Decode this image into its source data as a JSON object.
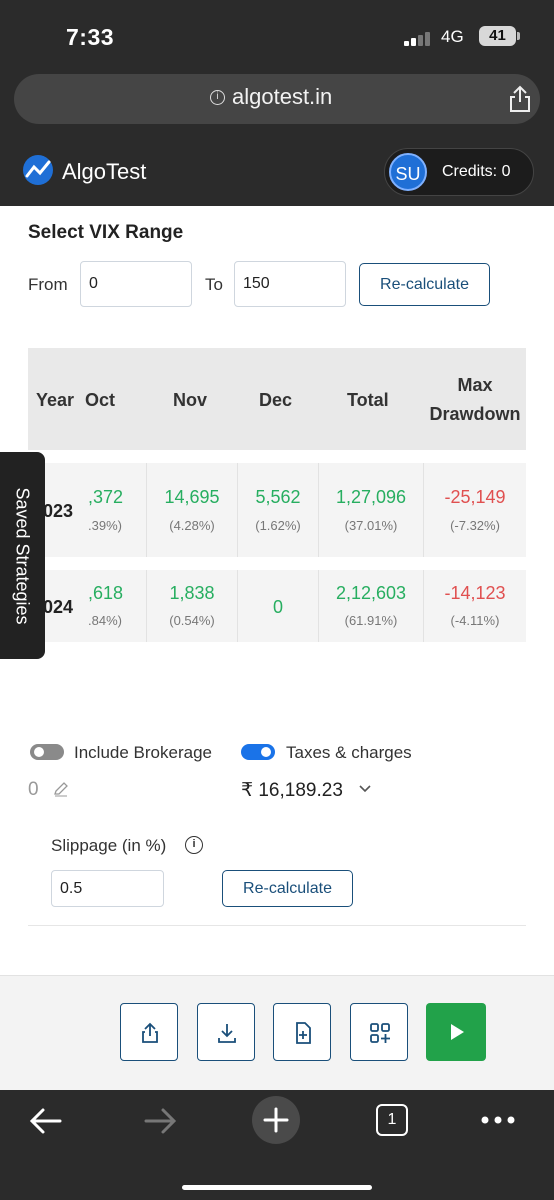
{
  "status_bar": {
    "time": "7:33",
    "network": "4G",
    "battery": "41"
  },
  "browser": {
    "url": "algotest.in"
  },
  "header": {
    "brand": "AlgoTest",
    "avatar_initials": "SU",
    "credits": "Credits: 0"
  },
  "vix": {
    "title": "Select VIX Range",
    "from_label": "From",
    "from_value": "0",
    "to_label": "To",
    "to_value": "150",
    "recalc_label": "Re-calculate"
  },
  "table": {
    "headers": {
      "year": "Year",
      "oct": "Oct",
      "nov": "Nov",
      "dec": "Dec",
      "total": "Total",
      "max1": "Max",
      "max2": "Drawdown"
    },
    "rows": [
      {
        "year": "023",
        "oct": ",372",
        "oct_pct": ".39%)",
        "nov": "14,695",
        "nov_pct": "(4.28%)",
        "dec": "5,562",
        "dec_pct": "(1.62%)",
        "total": "1,27,096",
        "total_pct": "(37.01%)",
        "mdd": "-25,149",
        "mdd_pct": "(-7.32%)"
      },
      {
        "year": "024",
        "oct": ",618",
        "oct_pct": ".84%)",
        "nov": "1,838",
        "nov_pct": "(0.54%)",
        "dec": "0",
        "dec_pct": "",
        "total": "2,12,603",
        "total_pct": "(61.91%)",
        "mdd": "-14,123",
        "mdd_pct": "(-4.11%)"
      }
    ]
  },
  "saved_strategies": "Saved Strategies",
  "brokerage": {
    "label": "Include Brokerage",
    "enabled": false,
    "value": "0"
  },
  "taxes": {
    "label": "Taxes & charges",
    "enabled": true,
    "value": "₹ 16,189.23"
  },
  "slippage": {
    "label": "Slippage (in %)",
    "value": "0.5",
    "recalc_label": "Re-calculate"
  },
  "colors": {
    "profit": "#27ae60",
    "loss": "#e05050",
    "accent": "#1a4f7a",
    "run": "#22a24a",
    "toggle_on": "#1a73e8"
  },
  "actions": [
    "share-icon",
    "download-icon",
    "add-file-icon",
    "add-widget-icon",
    "play-icon"
  ],
  "tabs_count": "1"
}
